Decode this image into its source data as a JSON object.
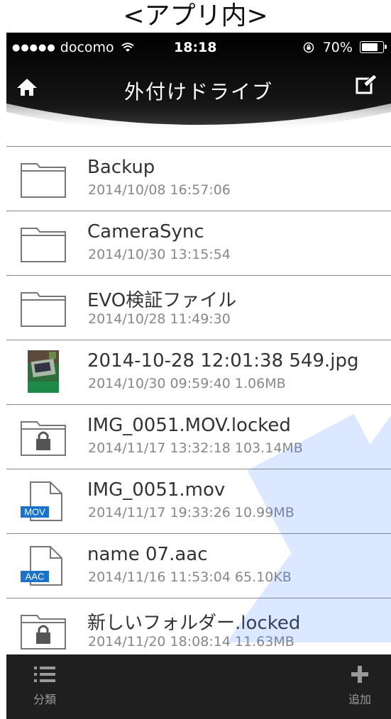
{
  "caption": "<アプリ内>",
  "status": {
    "carrier": "docomo",
    "time": "18:18",
    "battery": "70%"
  },
  "nav": {
    "title": "外付けドライブ"
  },
  "files": [
    {
      "name": "Backup",
      "meta": "2014/10/08 16:57:06",
      "icon": "folder-icon"
    },
    {
      "name": "CameraSync",
      "meta": "2014/10/30 13:15:54",
      "icon": "folder-icon"
    },
    {
      "name": "EVO検証ファイル",
      "meta": "2014/10/28 11:49:30",
      "icon": "folder-icon"
    },
    {
      "name": "2014-10-28 12:01:38 549.jpg",
      "meta": "2014/10/30 09:59:40 1.06MB",
      "icon": "image-thumbnail"
    },
    {
      "name": "IMG_0051.MOV.locked",
      "meta": "2014/11/17 13:32:18 103.14MB",
      "icon": "locked-folder-icon"
    },
    {
      "name": "IMG_0051.mov",
      "meta": "2014/11/17 19:33:26 10.99MB",
      "icon": "mov-file-icon",
      "badge": "MOV"
    },
    {
      "name": "name 07.aac",
      "meta": "2014/11/16 11:53:04 65.10KB",
      "icon": "aac-file-icon",
      "badge": "AAC"
    },
    {
      "name": "新しいフォルダー.locked",
      "meta": "2014/11/20 18:08:14 11.63MB",
      "icon": "locked-folder-icon"
    }
  ],
  "tabbar": {
    "left_label": "分類",
    "right_label": "追加"
  },
  "colors": {
    "header_bg": "#0d0d0d",
    "badge_blue": "#1a73c8",
    "tabbar_bg": "#1f1f1f"
  }
}
